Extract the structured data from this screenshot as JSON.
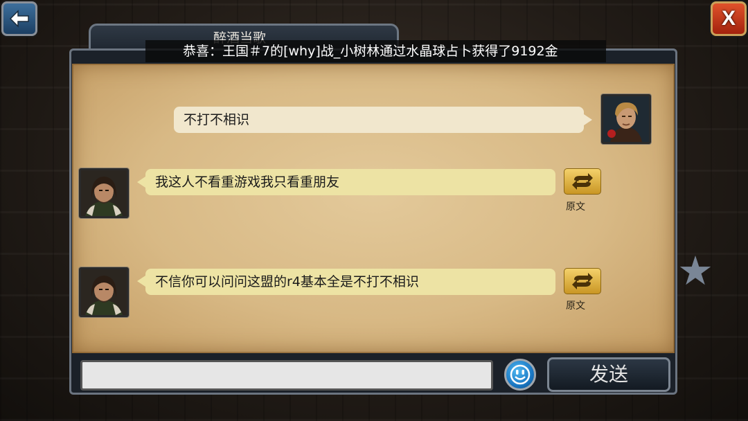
{
  "header": {
    "tab_title": "醉酒当歌",
    "announcement": "恭喜：王国＃7的[why]战_小树林通过水晶球占卜获得了9192金"
  },
  "messages": [
    {
      "side": "right",
      "text": "不打不相识"
    },
    {
      "side": "left",
      "text": "我这人不看重游戏我只看重朋友",
      "translate_label": "原文"
    },
    {
      "side": "left",
      "text": "不信你可以问问这盟的r4基本全是不打不相识",
      "translate_label": "原文"
    }
  ],
  "footer": {
    "input_value": "",
    "send_label": "发送"
  },
  "icons": {
    "back": "back-arrow-icon",
    "close": "close-x-icon",
    "translate": "translate-swap-icon",
    "emoji": "smiley-icon",
    "favorite": "star-icon"
  },
  "colors": {
    "parchment": "#d8b985",
    "bubble_self": "#f1e7cd",
    "bubble_other": "#ede3a4",
    "close_red": "#c9331a",
    "back_blue": "#2a5884"
  }
}
